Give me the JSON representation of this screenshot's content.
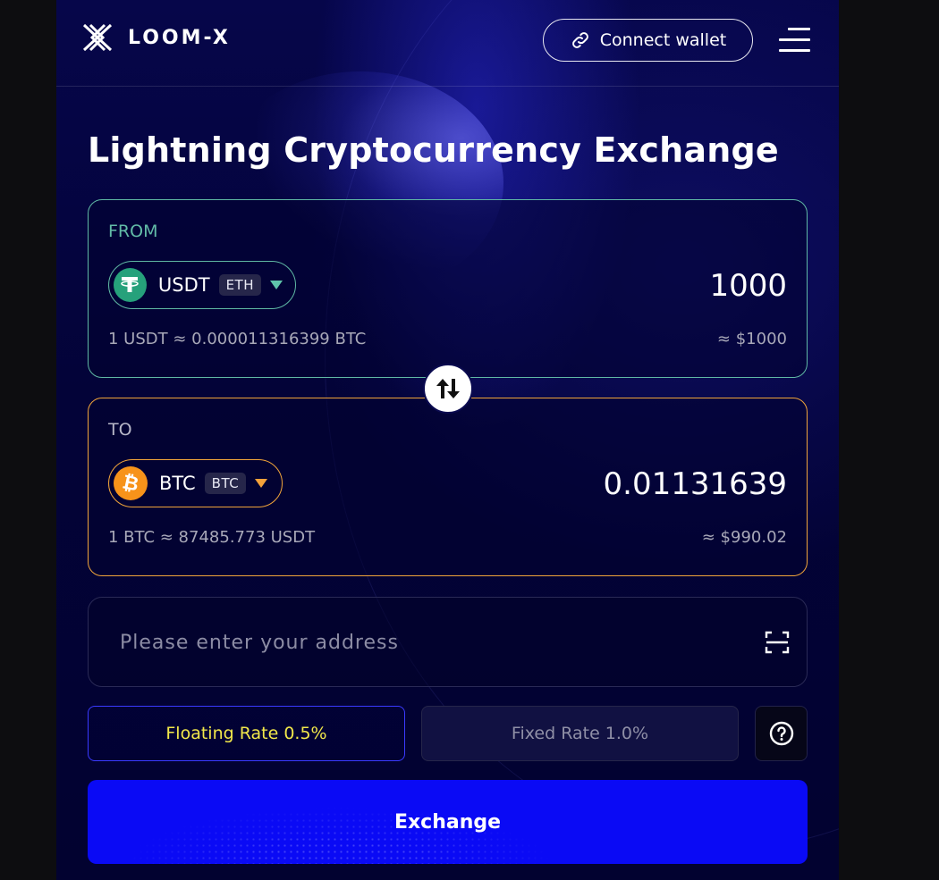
{
  "header": {
    "brand": "LOOM-X",
    "connect_label": "Connect wallet"
  },
  "main": {
    "title": "Lightning Cryptocurrency Exchange"
  },
  "from": {
    "label": "FROM",
    "symbol": "USDT",
    "network": "ETH",
    "amount": "1000",
    "rate": "1 USDT ≈ 0.000011316399 BTC",
    "usd": "≈ $1000",
    "accent": "#5fb8a4"
  },
  "to": {
    "label": "TO",
    "symbol": "BTC",
    "network": "BTC",
    "amount": "0.01131639",
    "rate": "1 BTC ≈ 87485.773 USDT",
    "usd": "≈ $990.02",
    "accent": "#f0a43a"
  },
  "address": {
    "placeholder": "Please enter your address",
    "value": ""
  },
  "rates": {
    "floating_label": "Floating Rate 0.5%",
    "fixed_label": "Fixed Rate 1.0%",
    "selected": "floating"
  },
  "actions": {
    "exchange_label": "Exchange"
  },
  "icons": {
    "logo": "loom-x-logo",
    "connect": "link-icon",
    "menu": "hamburger-menu-icon",
    "swap": "swap-arrows-icon",
    "scan": "qr-scan-icon",
    "help": "question-circle-icon",
    "from_coin": "tether-icon",
    "to_coin": "bitcoin-icon"
  },
  "colors": {
    "primary": "#0a0af5",
    "floating_text": "#f2e84a",
    "usdt": "#26a17b",
    "btc": "#f7931a"
  }
}
